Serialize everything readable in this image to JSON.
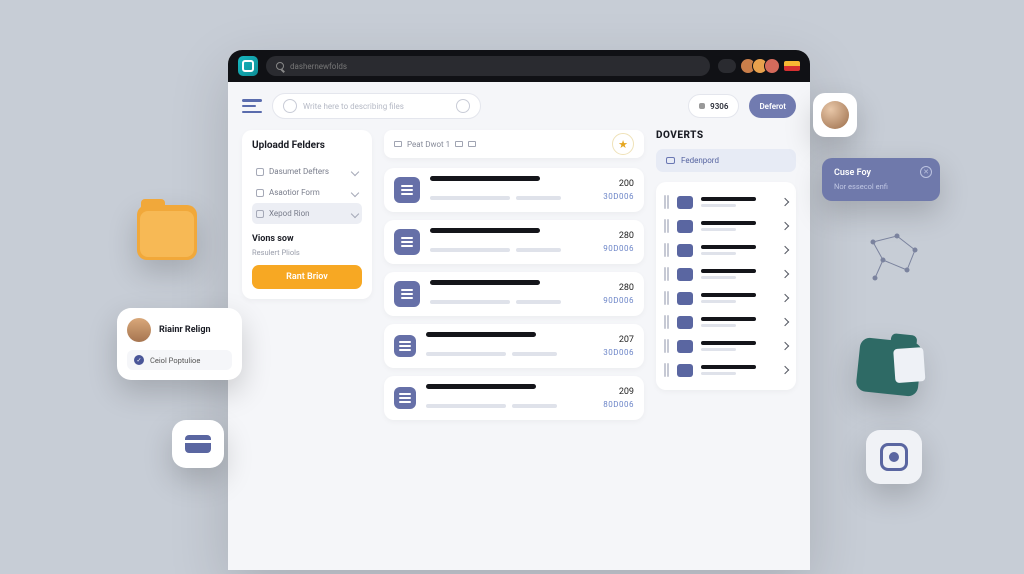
{
  "titlebar": {
    "url_placeholder": "dashernewfolds"
  },
  "header": {
    "search_placeholder": "Write here to describing files",
    "balance": "9306",
    "action_label": "Deferot"
  },
  "sidebar": {
    "title": "Uploadd Felders",
    "items": [
      {
        "label": "Dasumet Defters"
      },
      {
        "label": "Asaotior Form"
      },
      {
        "label": "Xepod Rion"
      }
    ],
    "upsell_title": "Vions sow",
    "upsell_text": "Resulert Pliols",
    "upsell_button": "Rant Briov"
  },
  "toolbar": {
    "label": "Peat Dwot 1"
  },
  "files": [
    {
      "n1": "200",
      "n2": "30D006"
    },
    {
      "n1": "280",
      "n2": "90D006"
    },
    {
      "n1": "280",
      "n2": "90D006"
    },
    {
      "n1": "207",
      "n2": "30D006"
    },
    {
      "n1": "209",
      "n2": "80D006"
    }
  ],
  "rail": {
    "title": "DOVERTS",
    "button": "Fedenpord"
  },
  "user_card": {
    "name": "Riainr Relign",
    "tag": "Ceiol Poptulioe"
  },
  "tooltip": {
    "title": "Cuse Foy",
    "subtitle": "Nor essecol enfi"
  },
  "colors": {
    "accent": "#6670a8",
    "orange": "#f7a823",
    "teal": "#2e6a65"
  }
}
